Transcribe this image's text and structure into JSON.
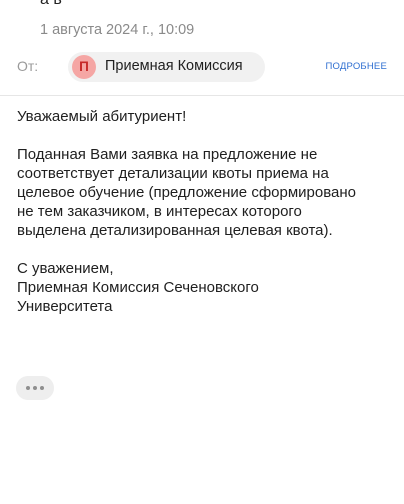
{
  "header": {
    "folder_partial": "а в",
    "date": "1 августа 2024 г., 10:09"
  },
  "sender": {
    "from_label": "От:",
    "avatar_letter": "П",
    "name": "Приемная Комиссия",
    "details_link": "ПОДРОБНЕЕ"
  },
  "message": {
    "greeting": "Уважаемый абитуриент!",
    "paragraph": "Поданная Вами заявка на предложение не\nсоответствует детализации квоты приема на\nцелевое обучение (предложение сформировано\nне тем заказчиком, в интересах которого\nвыделена детализированная целевая квота).",
    "signature": "С уважением,\nПриемная Комиссия Сеченовского\nУниверситета"
  },
  "colors": {
    "avatar_bg": "#f5a6a4",
    "avatar_fg": "#c62828",
    "link": "#2f6fd1"
  },
  "icons": {
    "more": "ellipsis-icon"
  }
}
